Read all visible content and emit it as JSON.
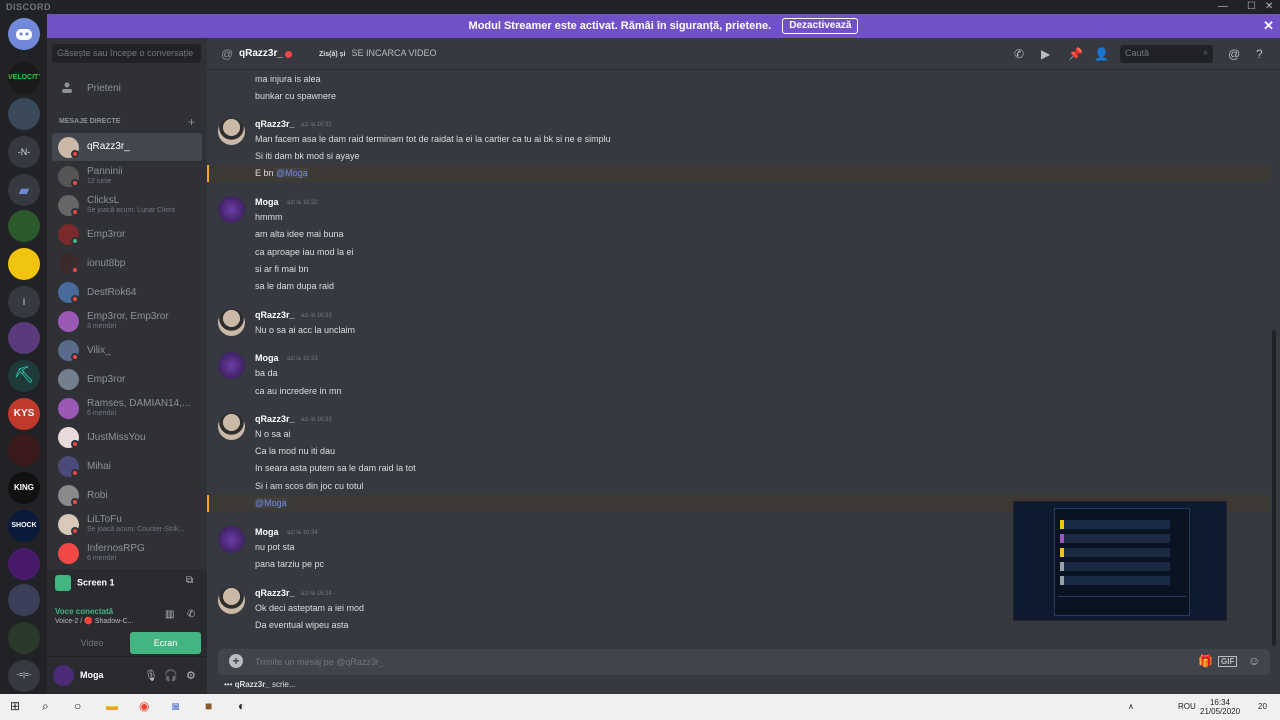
{
  "app": {
    "title": "DISCORD"
  },
  "banner": {
    "text": "Modul Streamer este activat. Rămâi în siguranță, prietene.",
    "button": "Dezactivează"
  },
  "guilds": [
    "VELOCITY",
    "-N-",
    "I",
    "KYS",
    "KING",
    "SHOCK",
    "-=|=-"
  ],
  "sidebar": {
    "search_placeholder": "Găsește sau începe o conversație",
    "friends": "Prieteni",
    "dm_header": "MESAJE DIRECTE",
    "dms": [
      {
        "name": "qRazz3r_",
        "sub": "",
        "active": true
      },
      {
        "name": "Panninii",
        "sub": "12 iunie",
        "active": false
      },
      {
        "name": "ClicksL",
        "sub": "Se joacă acum: Lunar Client",
        "active": false
      },
      {
        "name": "Emp3ror",
        "sub": "",
        "active": false
      },
      {
        "name": "ionut8bp",
        "sub": "",
        "active": false
      },
      {
        "name": "DestRok64",
        "sub": "",
        "active": false
      },
      {
        "name": "Emp3ror, Emp3ror",
        "sub": "3 membri",
        "active": false
      },
      {
        "name": "Vilix_",
        "sub": "",
        "active": false
      },
      {
        "name": "Emp3ror",
        "sub": "",
        "active": false
      },
      {
        "name": "Ramses, DAMIAN14,...",
        "sub": "6 membri",
        "active": false
      },
      {
        "name": "IJustMissYou",
        "sub": "",
        "active": false
      },
      {
        "name": "Mihai",
        "sub": "",
        "active": false
      },
      {
        "name": "Robi",
        "sub": "",
        "active": false
      },
      {
        "name": "LiLToFu",
        "sub": "Se joacă acum: Counter-Strik...",
        "active": false
      },
      {
        "name": "InfernosRPG",
        "sub": "6 membri",
        "active": false
      }
    ],
    "screen": "Screen 1",
    "voice_status": "Voce conectată",
    "voice_sub": "Voice-2 / 🔴 Shadow-C...",
    "video_btn": "Video",
    "screen_btn": "Ecran",
    "username": "Moga"
  },
  "header": {
    "at": "@",
    "title": "qRazz3r_",
    "status_prefix": "Zis(ă) și",
    "status": "SE INCARCA VIDEO",
    "search": "Caută"
  },
  "messages": {
    "l1": "ma injura is alea",
    "l2": "bunkar cu spawnere",
    "a1": "qRazz3r_",
    "t1": "azi la 16:32",
    "l3": "Man facem asa le dam raid terminam tot de raidat la ei la cartier ca tu ai bk si ne e simplu",
    "l4": "Si iti dam bk mod si ayaye",
    "l5": "E bn",
    "m5": "@Moga",
    "a2": "Moga",
    "t2": "azi la 16:32",
    "l6": "hmmm",
    "l7": "am alta idee mai buna",
    "l8": "ca aproape iau mod la ei",
    "l9": "si ar fi mai bn",
    "l10": "sa le dam dupa raid",
    "a3": "qRazz3r_",
    "t3": "azi la 16:33",
    "l11": "Nu o sa ai acc la unclaim",
    "a4": "Moga",
    "t4": "azi la 16:33",
    "l12": "ba da",
    "l13": "ca au incredere in mn",
    "a5": "qRazz3r_",
    "t5": "azi la 16:33",
    "l14": "N o sa ai",
    "l15": "Ca la mod nu iti dau",
    "l16": "In seara asta putem sa le dam raid la tot",
    "l17": "Si i am scos din joc cu totul",
    "m18": "@Moga",
    "a6": "Moga",
    "t6": "azi la 16:34",
    "l19": "nu pot sta",
    "l20": "pana tarziu pe pc",
    "a7": "qRazz3r_",
    "t7": "azi la 16:34",
    "l21": "Ok deci asteptam a iei mod",
    "l22": "Da eventual wipeu asta"
  },
  "input": {
    "placeholder": "Trimite un mesaj pe @qRazz3r_"
  },
  "typing": {
    "user": "qRazz3r_",
    "text": "scrie..."
  },
  "taskbar": {
    "lang": "ROU",
    "time": "16:34",
    "date": "21/05/2020",
    "notif": "20"
  }
}
